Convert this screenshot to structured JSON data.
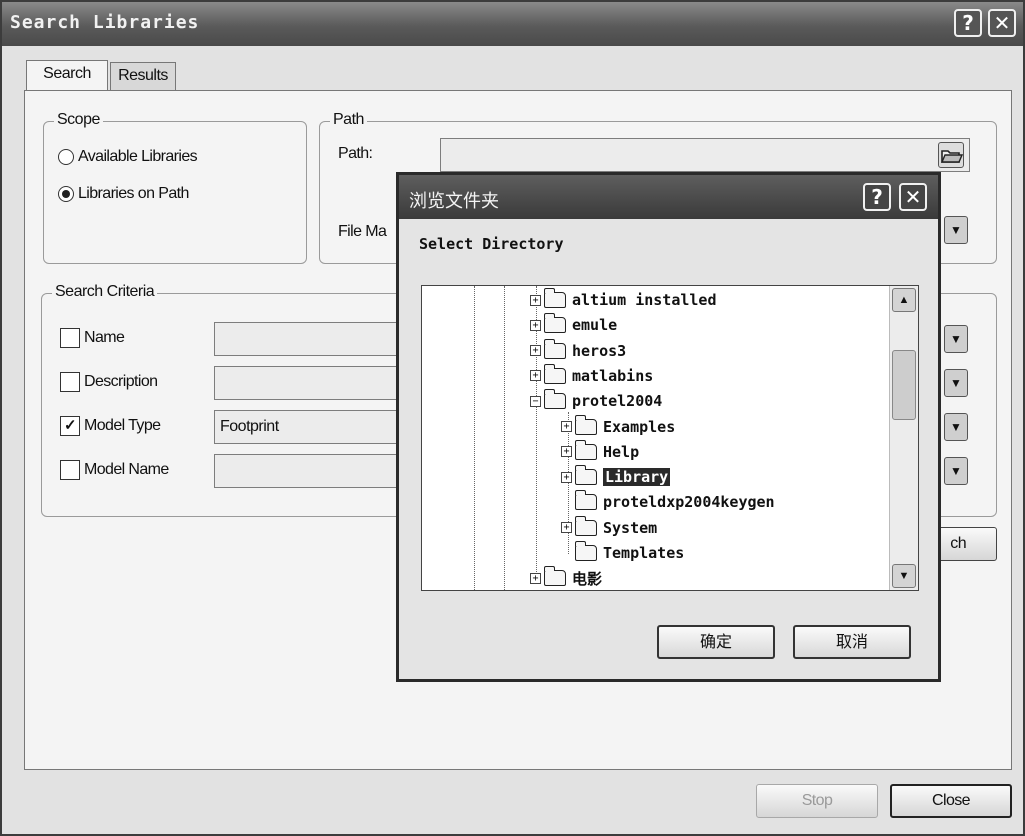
{
  "window": {
    "title": "Search Libraries",
    "help_glyph": "?",
    "close_glyph": "✕"
  },
  "tabs": [
    {
      "label": "Search"
    },
    {
      "label": "Results"
    }
  ],
  "scope": {
    "legend": "Scope",
    "options": [
      {
        "label": "Available Libraries",
        "selected": false
      },
      {
        "label": "Libraries on Path",
        "selected": true
      }
    ]
  },
  "path_group": {
    "legend": "Path",
    "path_label": "Path:",
    "path_value": "",
    "file_mask_label": "File Ma"
  },
  "criteria": {
    "legend": "Search Criteria",
    "rows": [
      {
        "label": "Name",
        "checked": false,
        "value": ""
      },
      {
        "label": "Description",
        "checked": false,
        "value": ""
      },
      {
        "label": "Model Type",
        "checked": true,
        "value": "Footprint"
      },
      {
        "label": "Model Name",
        "checked": false,
        "value": ""
      }
    ],
    "check_glyph": "✓",
    "dropdown_glyph": "▼"
  },
  "search_button_visible_text": "ch",
  "footer": {
    "stop_label": "Stop",
    "close_label": "Close"
  },
  "browse_dialog": {
    "title": "浏览文件夹",
    "help_glyph": "?",
    "close_glyph": "✕",
    "prompt": "Select Directory",
    "tree": [
      {
        "label": "altium installed",
        "level": 0,
        "expander": "+"
      },
      {
        "label": "emule",
        "level": 0,
        "expander": "+"
      },
      {
        "label": "heros3",
        "level": 0,
        "expander": "+"
      },
      {
        "label": "matlabins",
        "level": 0,
        "expander": "+"
      },
      {
        "label": "protel2004",
        "level": 0,
        "expander": "−"
      },
      {
        "label": "Examples",
        "level": 1,
        "expander": "+"
      },
      {
        "label": "Help",
        "level": 1,
        "expander": "+"
      },
      {
        "label": "Library",
        "level": 1,
        "expander": "+",
        "selected": true
      },
      {
        "label": "proteldxp2004keygen",
        "level": 1,
        "expander": ""
      },
      {
        "label": "System",
        "level": 1,
        "expander": "+"
      },
      {
        "label": "Templates",
        "level": 1,
        "expander": ""
      },
      {
        "label": "电影",
        "level": 0,
        "expander": "+"
      }
    ],
    "scroll_up_glyph": "▲",
    "scroll_down_glyph": "▼",
    "ok_label": "确定",
    "cancel_label": "取消"
  }
}
